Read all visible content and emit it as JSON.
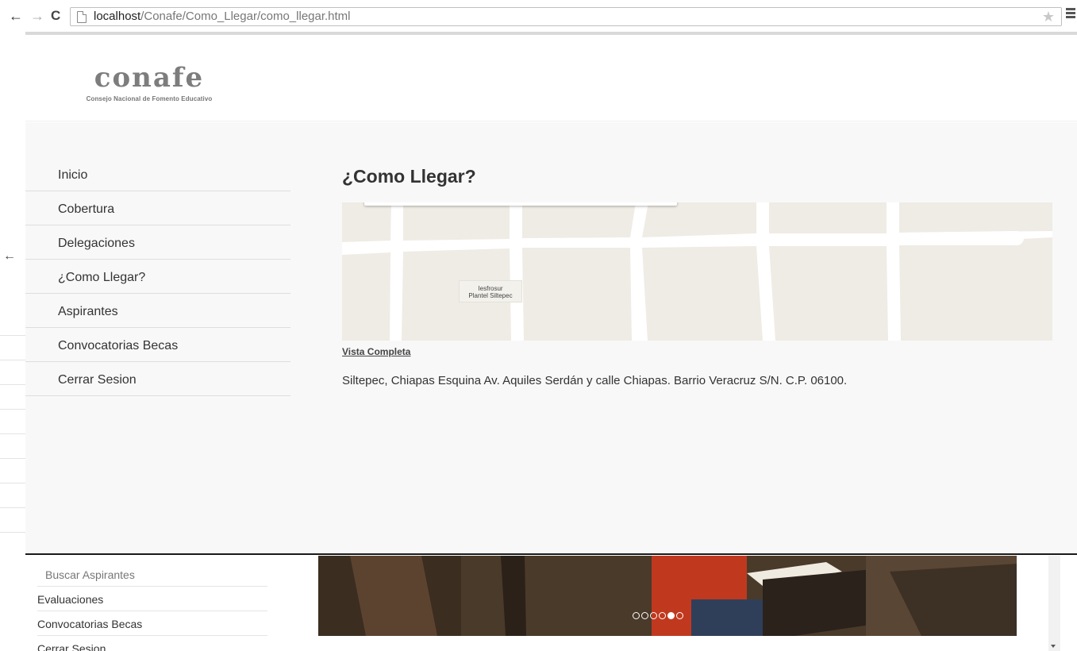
{
  "browser": {
    "url_host": "localhost",
    "url_path": "/Conafe/Como_Llegar/como_llegar.html"
  },
  "header": {
    "logo_word": "conafe",
    "logo_subtitle": "Consejo Nacional de Fomento Educativo"
  },
  "side_menu": {
    "items": [
      {
        "label": "Inicio"
      },
      {
        "label": "Cobertura"
      },
      {
        "label": "Delegaciones"
      },
      {
        "label": "¿Como Llegar?"
      },
      {
        "label": "Aspirantes"
      },
      {
        "label": "Convocatorias Becas"
      },
      {
        "label": "Cerrar Sesion"
      }
    ]
  },
  "main": {
    "title": "¿Como Llegar?",
    "map_label_line1": "Iesfrosur",
    "map_label_line2": "Plantel Siltepec",
    "map_link": "Vista Completa",
    "address": "Siltepec, Chiapas Esquina Av. Aquiles Serdán y calle Chiapas. Barrio Veracruz S/N. C.P. 06100."
  },
  "background_menu": {
    "items": [
      {
        "label": "Buscar Aspirantes"
      },
      {
        "label": "Evaluaciones"
      },
      {
        "label": "Convocatorias Becas"
      },
      {
        "label": "Cerrar Sesion"
      }
    ]
  },
  "carousel": {
    "slide_count": 6,
    "active_index": 4
  },
  "colors": {
    "map_block": "#efece5",
    "map_road": "#ffffff",
    "overlay_bg": "#f8f8f8"
  }
}
